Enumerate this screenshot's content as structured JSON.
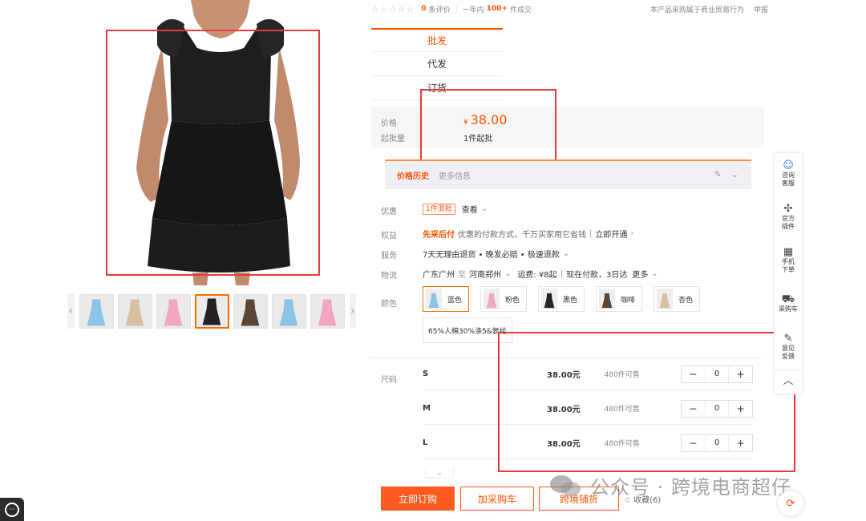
{
  "top": {
    "review_count": "0",
    "review_label": "条评价",
    "period_label": "一年内",
    "sold_count": "100+",
    "sold_label": "件成交",
    "notice": "本产品采购属于商业贸易行为",
    "report": "举报"
  },
  "mode_tabs": [
    {
      "label": "批发"
    },
    {
      "label": "代发"
    },
    {
      "label": "订货"
    }
  ],
  "price": {
    "label": "价格",
    "currency": "¥",
    "value": "38.00",
    "min_label": "起批量",
    "min_value": "1件起批"
  },
  "history": {
    "tab1": "价格历史",
    "tab2": "更多信息"
  },
  "attrs": {
    "discount_label": "优惠",
    "discount_tag": "1件混批",
    "discount_more": "查看",
    "rights_label": "权益",
    "rights_title": "先采后付",
    "rights_desc": "优惠的付款方式，千万买家用它省钱",
    "rights_link": "立即开通",
    "service_label": "服务",
    "service_value": "7天无理由退货 • 晚发必赔 • 极速退款",
    "logistics_label": "物流",
    "logistics_from": "广东广州",
    "logistics_to_word": "至",
    "logistics_to": "河南郑州",
    "logistics_fee": "运费: ¥8起",
    "logistics_eta": "现在付款，3日达",
    "logistics_more": "更多",
    "color_label": "颜色",
    "material": "65%人棉30%涤5&氨纶",
    "size_label": "尺码"
  },
  "colors": [
    {
      "name": "蓝色",
      "swatch": "#8cc4e6",
      "active": true
    },
    {
      "name": "粉色",
      "swatch": "#f2a6c6",
      "active": false
    },
    {
      "name": "黑色",
      "swatch": "#222222",
      "active": false
    },
    {
      "name": "咖啡",
      "swatch": "#5a4536",
      "active": false
    },
    {
      "name": "杏色",
      "swatch": "#d9bfa2",
      "active": false
    }
  ],
  "sizes": [
    {
      "name": "S",
      "price": "38.00元",
      "stock": "480件可售",
      "qty": "0"
    },
    {
      "name": "M",
      "price": "38.00元",
      "stock": "480件可售",
      "qty": "0"
    },
    {
      "name": "L",
      "price": "38.00元",
      "stock": "480件可售",
      "qty": "0"
    }
  ],
  "actions": {
    "buy": "立即订购",
    "cart": "加采购车",
    "cross": "跨境铺货",
    "favorite": "收藏(6)"
  },
  "toolbar": [
    {
      "label": "咨询\n客服",
      "icon": "customer-service-icon"
    },
    {
      "label": "官方\n插件",
      "icon": "plugin-icon"
    },
    {
      "label": "手机\n下单",
      "icon": "qr-code-icon"
    },
    {
      "label": "采购车",
      "icon": "cart-icon"
    },
    {
      "label": "意见\n反馈",
      "icon": "feedback-icon"
    }
  ],
  "watermark": "公众号 · 跨境电商超仔",
  "thumbnails": [
    {
      "color": "#8cc4e6"
    },
    {
      "color": "#d9bfa2"
    },
    {
      "color": "#f2a6c6"
    },
    {
      "color": "#222222"
    },
    {
      "color": "#5a4536"
    },
    {
      "color": "#8cc4e6"
    },
    {
      "color": "#f2a6c6"
    }
  ],
  "colors_theme": {
    "accent": "#ff5000",
    "annotation_red": "#e23b3b"
  }
}
